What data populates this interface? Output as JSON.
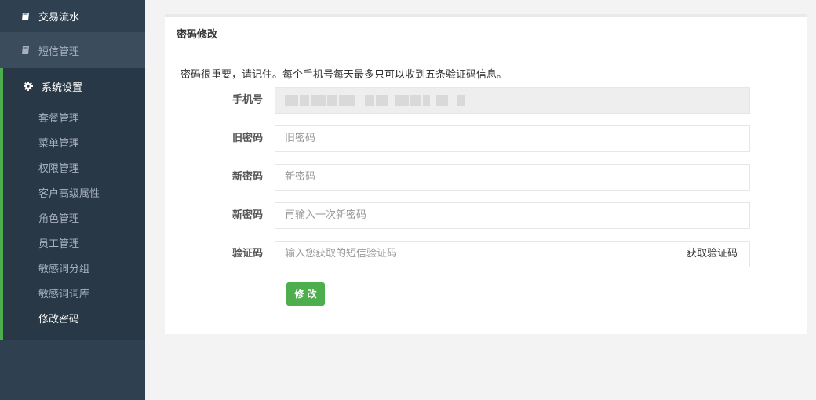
{
  "sidebar": {
    "items": [
      {
        "label": "交易流水",
        "icon": "book-icon"
      },
      {
        "label": "短信管理",
        "icon": "book-icon"
      }
    ],
    "section": {
      "label": "系统设置",
      "icon": "gear-icon",
      "children": [
        "套餐管理",
        "菜单管理",
        "权限管理",
        "客户高级属性",
        "角色管理",
        "员工管理",
        "敏感词分组",
        "敏感词词库",
        "修改密码"
      ],
      "active": "修改密码"
    }
  },
  "main": {
    "title": "密码修改",
    "notice": "密码很重要，请记住。每个手机号每天最多只可以收到五条验证码信息。",
    "form": {
      "phone_label": "手机号",
      "old_label": "旧密码",
      "old_placeholder": "旧密码",
      "new_label": "新密码",
      "new_placeholder": "新密码",
      "confirm_label": "新密码",
      "confirm_placeholder": "再输入一次新密码",
      "code_label": "验证码",
      "code_placeholder": "输入您获取的短信验证码",
      "code_button": "获取验证码",
      "submit": "修 改"
    }
  },
  "colors": {
    "sidebar_bg": "#2f4050",
    "accent_green": "#4cae4c"
  }
}
